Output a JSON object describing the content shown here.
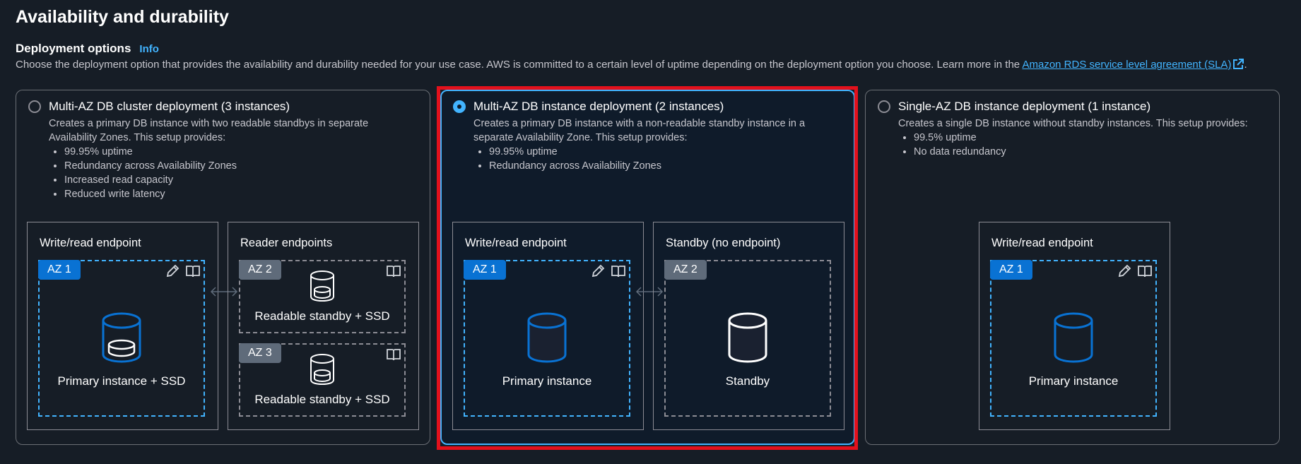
{
  "section": {
    "title": "Availability and durability",
    "subtitle": "Deployment options",
    "info": "Info",
    "description": "Choose the deployment option that provides the availability and durability needed for your use case. AWS is committed to a certain level of uptime depending on the deployment option you choose. Learn more in the",
    "link": "Amazon RDS service level agreement (SLA)",
    "period": "."
  },
  "options": [
    {
      "title": "Multi-AZ DB cluster deployment (3 instances)",
      "description": "Creates a primary DB instance with two readable standbys in separate Availability Zones. This setup provides:",
      "bullets": [
        "99.95% uptime",
        "Redundancy across Availability Zones",
        "Increased read capacity",
        "Reduced write latency"
      ],
      "selected": false,
      "panels": [
        {
          "title": "Write/read endpoint",
          "zones": [
            {
              "tag": "AZ 1",
              "label": "Primary instance + SSD"
            }
          ]
        },
        {
          "title": "Reader endpoints",
          "zones": [
            {
              "tag": "AZ 2",
              "label": "Readable standby + SSD"
            },
            {
              "tag": "AZ 3",
              "label": "Readable standby + SSD"
            }
          ]
        }
      ]
    },
    {
      "title": "Multi-AZ DB instance deployment (2 instances)",
      "description": "Creates a primary DB instance with a non-readable standby instance in a separate Availability Zone. This setup provides:",
      "bullets": [
        "99.95% uptime",
        "Redundancy across Availability Zones"
      ],
      "selected": true,
      "panels": [
        {
          "title": "Write/read endpoint",
          "zones": [
            {
              "tag": "AZ 1",
              "label": "Primary instance"
            }
          ]
        },
        {
          "title": "Standby (no endpoint)",
          "zones": [
            {
              "tag": "AZ 2",
              "label": "Standby"
            }
          ]
        }
      ]
    },
    {
      "title": "Single-AZ DB instance deployment (1 instance)",
      "description": "Creates a single DB instance without standby instances. This setup provides:",
      "bullets": [
        "99.5% uptime",
        "No data redundancy"
      ],
      "selected": false,
      "panels": [
        {
          "title": "Write/read endpoint",
          "zones": [
            {
              "tag": "AZ 1",
              "label": "Primary instance"
            }
          ]
        }
      ]
    }
  ],
  "icons": {
    "edit": "pencil-icon",
    "docs": "book-icon",
    "external": "external-link-icon",
    "database": "database-icon",
    "link": "double-arrow-icon"
  },
  "colors": {
    "accent": "#42b4ff",
    "az_blue": "#0972d3",
    "az_grey": "#5f6b7a",
    "highlight": "#e3111c",
    "background": "#161d26"
  }
}
